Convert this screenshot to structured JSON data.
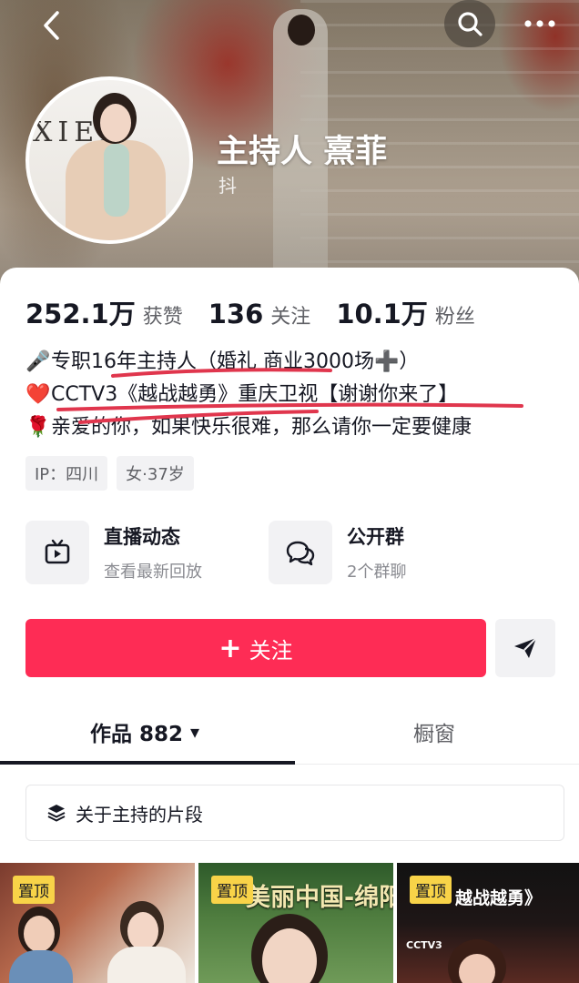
{
  "header": {
    "back_icon": "chevron-left-icon",
    "search_icon": "search-icon",
    "more_icon": "more-dots-icon",
    "avatar_text": "XIEF",
    "name": "主持人 熹菲",
    "platform_tag": "抖"
  },
  "stats": [
    {
      "value": "252.1万",
      "label": "获赞"
    },
    {
      "value": "136",
      "label": "关注"
    },
    {
      "value": "10.1万",
      "label": "粉丝"
    }
  ],
  "bio": [
    {
      "emoji": "🎤",
      "text": "专职16年主持人（婚礼 商业3000场➕）"
    },
    {
      "emoji": "❤️",
      "text": "CCTV3《越战越勇》重庆卫视【谢谢你来了】"
    },
    {
      "emoji": "🌹",
      "text": "亲爱的你，如果快乐很难，那么请你一定要健康"
    }
  ],
  "tags": [
    "IP：四川",
    "女·37岁"
  ],
  "shortcuts": [
    {
      "icon": "tv-icon",
      "title": "直播动态",
      "subtitle": "查看最新回放"
    },
    {
      "icon": "chat-bubbles-icon",
      "title": "公开群",
      "subtitle": "2个群聊"
    }
  ],
  "follow_button": {
    "plus": "+",
    "label": "关注"
  },
  "share_icon": "send-icon",
  "tabs": [
    {
      "label": "作品 882",
      "arrow": "▾",
      "active": true
    },
    {
      "label": "橱窗",
      "active": false
    }
  ],
  "collection": {
    "icon": "layers-icon",
    "label": "关于主持的片段"
  },
  "videos": [
    {
      "badge": "置顶",
      "caption": ""
    },
    {
      "badge": "置顶",
      "caption": "美丽中国-绵阳"
    },
    {
      "badge": "置顶",
      "caption": "越战越勇》",
      "logo": "CCTV3"
    }
  ],
  "colors": {
    "accent": "#fe2c55",
    "pin_badge": "#f8d348",
    "scribble": "#e0364d"
  }
}
